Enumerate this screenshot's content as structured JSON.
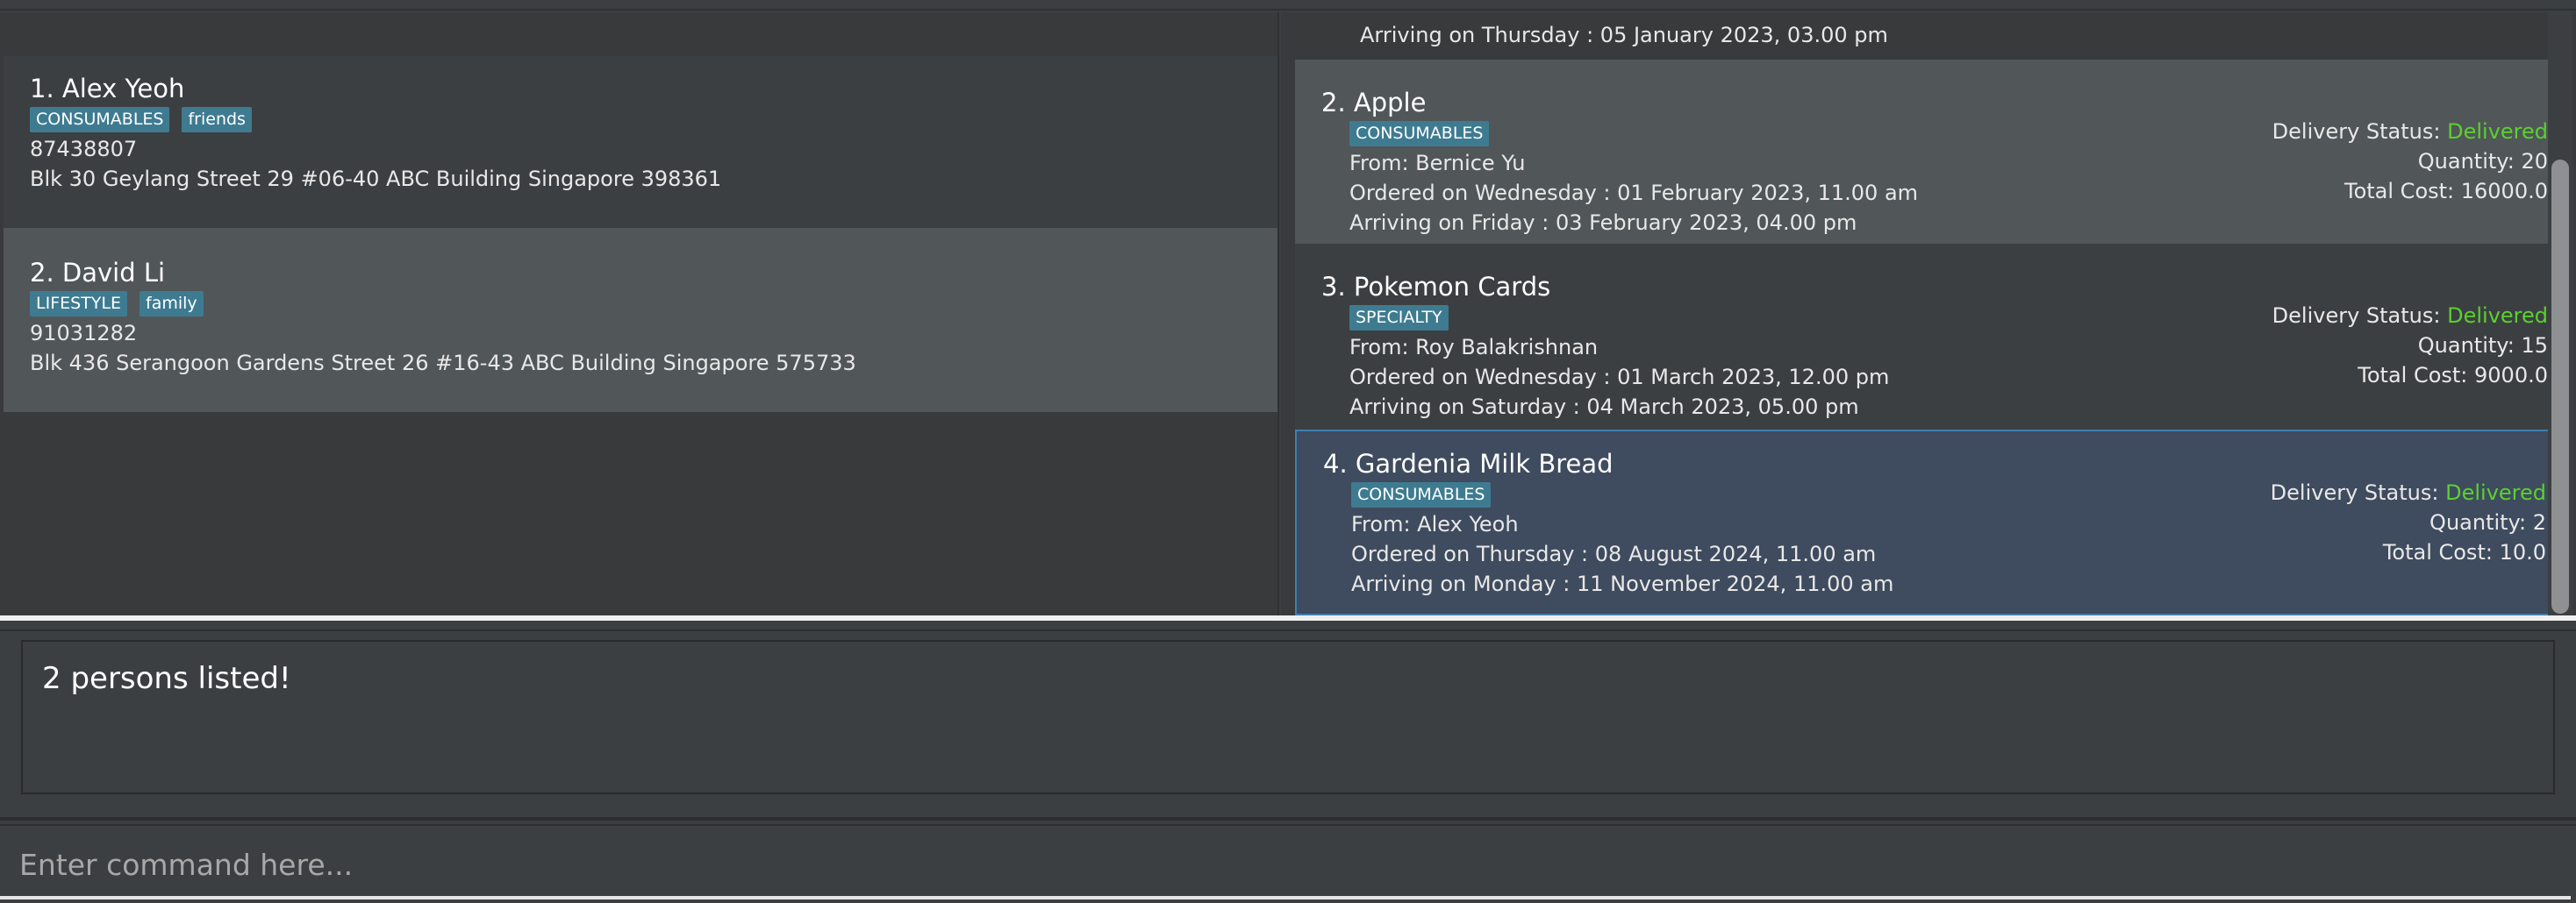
{
  "persons": [
    {
      "title": "1. Alex Yeoh",
      "tags": [
        "CONSUMABLES",
        "friends"
      ],
      "phone": "87438807",
      "address": "Blk 30 Geylang Street 29 #06-40 ABC Building Singapore 398361"
    },
    {
      "title": "2. David Li",
      "tags": [
        "LIFESTYLE",
        "family"
      ],
      "phone": "91031282",
      "address": "Blk 436 Serangoon Gardens Street 26 #16-43 ABC Building Singapore 575733"
    }
  ],
  "deliveries": [
    {
      "arriving": "Arriving on Thursday : 05 January 2023, 03.00 pm"
    },
    {
      "title": "2. Apple",
      "tag": "CONSUMABLES",
      "from": "From: Bernice Yu",
      "ordered": "Ordered on Wednesday : 01 February 2023, 11.00 am",
      "arriving": "Arriving on Friday : 03 February 2023, 04.00 pm",
      "status_label": "Delivery Status: ",
      "status_value": "Delivered",
      "quantity": "Quantity: 20",
      "total_cost": "Total Cost: 16000.0"
    },
    {
      "title": "3. Pokemon Cards",
      "tag": "SPECIALTY",
      "from": "From: Roy Balakrishnan",
      "ordered": "Ordered on Wednesday : 01 March 2023, 12.00 pm",
      "arriving": "Arriving on Saturday : 04 March 2023, 05.00 pm",
      "status_label": "Delivery Status: ",
      "status_value": "Delivered",
      "quantity": "Quantity: 15",
      "total_cost": "Total Cost: 9000.0"
    },
    {
      "title": "4. Gardenia Milk Bread",
      "tag": "CONSUMABLES",
      "from": "From: Alex Yeoh",
      "ordered": "Ordered on Thursday : 08 August 2024, 11.00 am",
      "arriving": "Arriving on Monday : 11 November 2024, 11.00 am",
      "status_label": "Delivery Status: ",
      "status_value": "Delivered",
      "quantity": "Quantity: 2",
      "total_cost": "Total Cost: 10.0"
    }
  ],
  "result_display": {
    "text": "2 persons listed!"
  },
  "command_box": {
    "value": "",
    "placeholder": "Enter command here..."
  },
  "colors": {
    "background": "#3c3f41",
    "selected_card": "#515658",
    "focused_card": "#3f4b5e",
    "tag": "#3e7b91",
    "delivered": "#5ad12f"
  }
}
